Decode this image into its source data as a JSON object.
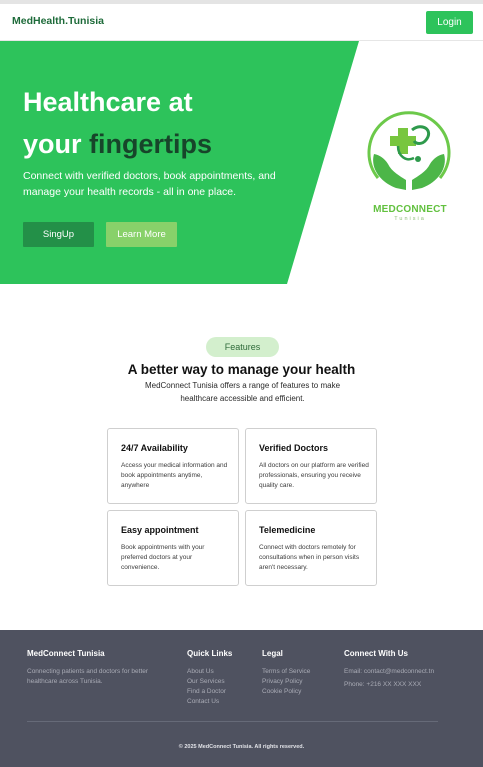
{
  "nav": {
    "brand": "MedHealth.Tunisia",
    "login_label": "Login"
  },
  "hero": {
    "title_line1": "Healthcare at",
    "title_line2_prefix": "your ",
    "title_line2_accent": "fingertips",
    "subtitle": "Connect with verified doctors, book appointments, and manage your health records - all in one place.",
    "signup_label": "SingUp",
    "learn_more_label": "Learn More"
  },
  "logo": {
    "name": "MEDCONNECT",
    "sub": "Tunisia"
  },
  "features": {
    "pill": "Features",
    "title": "A better way to manage your health",
    "subtitle": "MedConnect Tunisia offers a range of features to make healthcare accessible and efficient.",
    "cards": [
      {
        "title": "24/7 Availability",
        "text": "Access your medical information and book appointments anytime, anywhere"
      },
      {
        "title": "Verified Doctors",
        "text": "All doctors on our platform are verified professionals, ensuring you receive quality care."
      },
      {
        "title": "Easy appointment",
        "text": "Book appointments with your preferred doctors at your convenience."
      },
      {
        "title": "Telemedicine",
        "text": "Connect with doctors remotely for consultations when in person visits aren't necessary."
      }
    ]
  },
  "footer": {
    "brand_title": "MedConnect Tunisia",
    "brand_text": "Connecting patients and doctors for better healthcare across Tunisia.",
    "quick_links_title": "Quick Links",
    "quick_links": [
      "About Us",
      "Our Services",
      "Find a Doctor",
      "Contact Us"
    ],
    "legal_title": "Legal",
    "legal_links": [
      "Terms of Service",
      "Privacy Policy",
      "Cookie Policy"
    ],
    "connect_title": "Connect With Us",
    "email": "Email: contact@medconnect.tn",
    "phone": "Phone: +216 XX XXX XXX",
    "copyright": "© 2025 MedConnect Tunisia. All rights reserved."
  },
  "colors": {
    "hero_green": "#2dc35b",
    "accent_dark": "#17452a",
    "logo_green": "#62c13f",
    "footer_bg": "#4f5260"
  }
}
